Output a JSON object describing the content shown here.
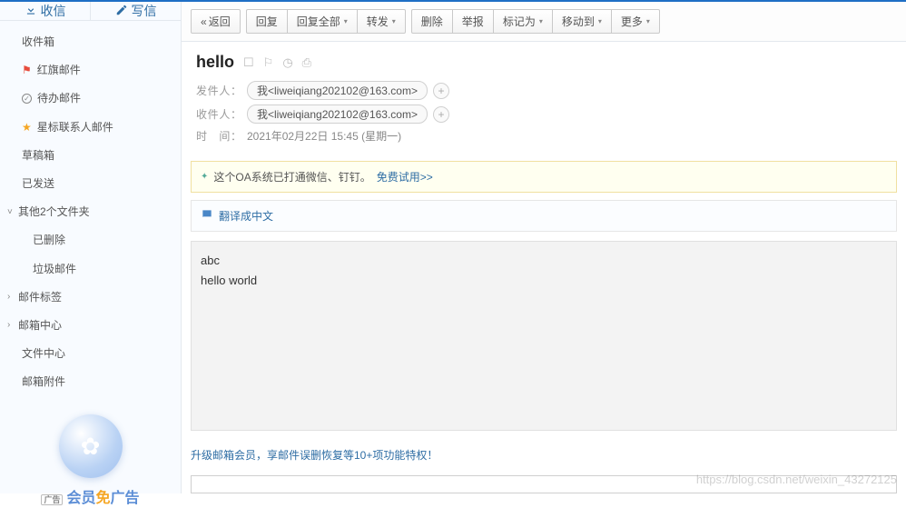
{
  "sidebar": {
    "receive": "收信",
    "compose": "写信",
    "items": [
      {
        "label": "收件箱"
      },
      {
        "label": "红旗邮件",
        "icon": "flag"
      },
      {
        "label": "待办邮件",
        "icon": "clock"
      },
      {
        "label": "星标联系人邮件",
        "icon": "star"
      },
      {
        "label": "草稿箱"
      },
      {
        "label": "已发送"
      },
      {
        "label": "其他2个文件夹",
        "exp": "v"
      },
      {
        "label": "已删除",
        "indent": true
      },
      {
        "label": "垃圾邮件",
        "indent": true
      },
      {
        "label": "邮件标签",
        "exp": ">"
      },
      {
        "label": "邮箱中心",
        "exp": ">"
      },
      {
        "label": "文件中心"
      },
      {
        "label": "邮箱附件"
      }
    ],
    "ad_prefix": "广告",
    "ad1": "会员",
    "ad2": "免",
    "ad3": "广告"
  },
  "toolbar": {
    "back": "返回",
    "reply": "回复",
    "reply_all": "回复全部",
    "forward": "转发",
    "delete": "删除",
    "report": "举报",
    "mark_as": "标记为",
    "move_to": "移动到",
    "more": "更多"
  },
  "message": {
    "subject": "hello",
    "sender_label": "发件人：",
    "sender": "我<liweiqiang202102@163.com>",
    "recipient_label": "收件人：",
    "recipient": "我<liweiqiang202102@163.com>",
    "time_label": "时　间：",
    "time": "2021年02月22日 15:45 (星期一)"
  },
  "banner1": {
    "text": "这个OA系统已打通微信、钉钉。",
    "link": "免费试用>>"
  },
  "banner2": {
    "text": "翻译成中文"
  },
  "body": {
    "line1": "abc",
    "line2": "hello world"
  },
  "promo": {
    "text": "升级邮箱会员，享邮件误删恢复等10+项功能特权！"
  },
  "reply_placeholder": "",
  "watermark": "https://blog.csdn.net/weixin_43272125"
}
